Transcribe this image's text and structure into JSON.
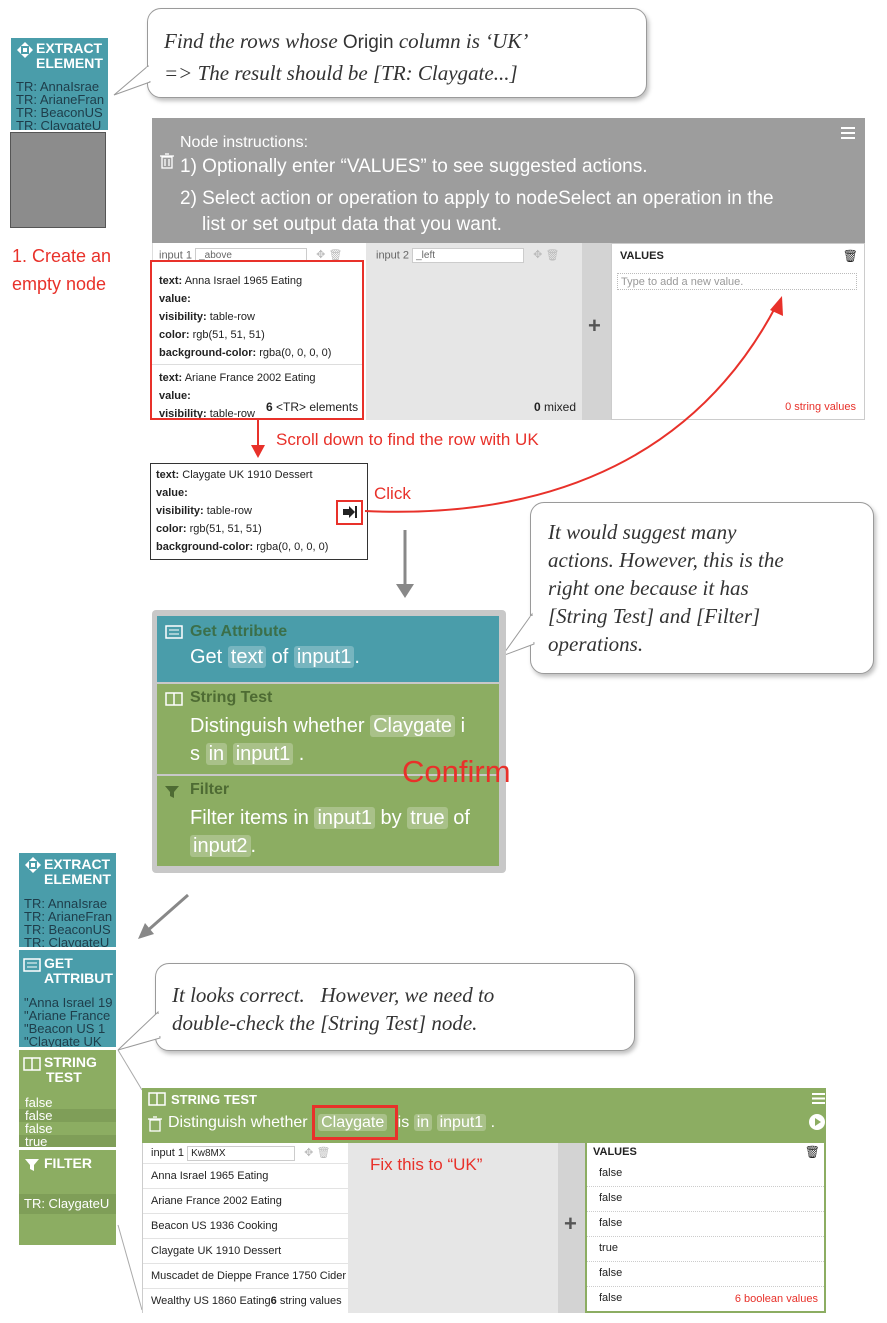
{
  "callout1": {
    "line1_pre": "Find the rows whose ",
    "line1_code": "Origin",
    "line1_post": " column is ‘UK’",
    "line2": "=> The result should be [TR: Claygate...]"
  },
  "extract_top": {
    "title1": "EXTRACT",
    "title2": "ELEMENT",
    "items": [
      "TR: AnnaIsrae",
      "TR: ArianeFran",
      "TR: BeaconUS",
      "TR: ClaygateU"
    ]
  },
  "step1": {
    "line1": "1. Create an",
    "line2": "empty node"
  },
  "node_panel": {
    "instructions_title": "Node instructions:",
    "instr1": "1) Optionally enter “VALUES” to see suggested actions.",
    "instr2a": "2) Select action or operation to apply to nodeSelect an operation in the",
    "instr2b": "list or set output data that you want.",
    "input1_label": "input 1",
    "input1_value": "_above",
    "input2_label": "input 2",
    "input2_value": "_left",
    "values_label": "VALUES",
    "values_placeholder": "Type to add a new value.",
    "card1": {
      "text": "Anna Israel 1965 Eating",
      "value": "",
      "visibility": "table-row",
      "color": "rgb(51, 51, 51)",
      "background": "rgba(0, 0, 0, 0)"
    },
    "card2": {
      "text": "Ariane France 2002 Eating",
      "value": "",
      "visibility": "table-row"
    },
    "count_num": "6",
    "count_text": "<TR> elements",
    "mixed_num": "0",
    "mixed_text": "mixed",
    "string_values": "0 string values",
    "plus": "+"
  },
  "labels": {
    "key_text": "text:",
    "key_value": "value:",
    "key_visibility": "visibility:",
    "key_color": "color:",
    "key_bg": "background-color:"
  },
  "scroll_note": "Scroll down to find the row with UK",
  "detail_card": {
    "text": "Claygate UK 1910 Dessert",
    "value": "",
    "visibility": "table-row",
    "color": "rgb(51, 51, 51)",
    "background": "rgba(0, 0, 0, 0)"
  },
  "click_label": "Click",
  "callout2": {
    "l1": "It would suggest many",
    "l2": "actions. However, this is the",
    "l3": "right one because it has",
    "l4": "[String Test] and [Filter]",
    "l5": "operations."
  },
  "suggestion": {
    "get_attr_title": "Get Attribute",
    "get_attr_pre": "Get ",
    "get_attr_chip1": "text",
    "get_attr_mid": " of ",
    "get_attr_chip2": "input1",
    "get_attr_post": ".",
    "string_test_title": "String Test",
    "st_pre": "Distinguish whether ",
    "st_chip1": "Claygate",
    "st_mid": " i",
    "st_l2_pre": "s ",
    "st_chip2": "in",
    "st_chip3": "input1",
    "st_post": " .",
    "filter_title": "Filter",
    "f_pre": "Filter items in ",
    "f_chip1": "input1",
    "f_mid": " by ",
    "f_chip2": "true",
    "f_post": " of",
    "f_chip3": "input2",
    "f_end": "."
  },
  "confirm": "Confirm",
  "pipeline": {
    "extract_title1": "EXTRACT",
    "extract_title2": "ELEMENT",
    "extract_items": [
      "TR: AnnaIsrae",
      "TR: ArianeFran",
      "TR: BeaconUS",
      "TR: ClaygateU"
    ],
    "get_title1": "GET",
    "get_title2": "ATTRIBUT",
    "get_items": [
      "\"Anna Israel 19",
      "\"Ariane France",
      "\"Beacon US 1",
      "\"Claygate UK"
    ],
    "string_title1": "STRING",
    "string_title2": "TEST",
    "string_items": [
      "false",
      "false",
      "false",
      "true"
    ],
    "filter_title": "FILTER",
    "filter_items": [
      "TR: ClaygateU"
    ]
  },
  "callout3": {
    "l1": "It looks correct.   However, we need to",
    "l2": "double-check the [String Test] node."
  },
  "string_panel": {
    "title": "STRING TEST",
    "desc_pre": "Distinguish whether ",
    "chip1": "Claygate",
    "mid": " is ",
    "chip2": "in",
    "chip3": "input1",
    "post": " .",
    "input1_label": "input 1",
    "input1_value": "Kw8MX",
    "rows": [
      "Anna Israel 1965 Eating",
      "Ariane France 2002 Eating",
      "Beacon US 1936 Cooking",
      "Claygate UK 1910 Dessert",
      "Muscadet de Dieppe France 1750 Cider",
      "Wealthy US 1860 Eating"
    ],
    "count_num": "6",
    "count_text": "string values",
    "values_label": "VALUES",
    "values": [
      "false",
      "false",
      "false",
      "true",
      "false",
      "false"
    ],
    "bool_count": "6 boolean values",
    "plus": "+"
  },
  "fix_note": "Fix this to “UK”",
  "colors": {
    "teal": "#4a9daa",
    "green": "#8cad62",
    "red": "#e8312a",
    "gray": "#9d9d9d"
  }
}
